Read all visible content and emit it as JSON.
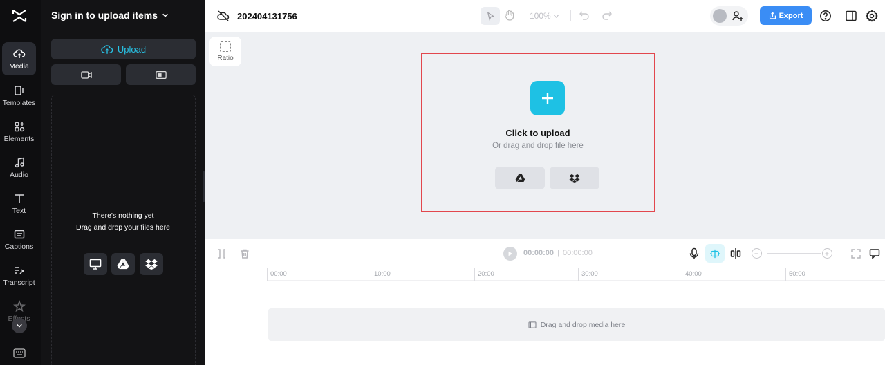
{
  "rail": {
    "items": [
      {
        "label": "Media"
      },
      {
        "label": "Templates"
      },
      {
        "label": "Elements"
      },
      {
        "label": "Audio"
      },
      {
        "label": "Text"
      },
      {
        "label": "Captions"
      },
      {
        "label": "Transcript"
      },
      {
        "label": "Effects"
      }
    ]
  },
  "panel": {
    "title": "Sign in to upload items",
    "upload_label": "Upload",
    "empty_title": "There's nothing yet",
    "empty_subtitle": "Drag and drop your files here"
  },
  "header": {
    "project_name": "202404131756",
    "zoom": "100%",
    "export_label": "Export"
  },
  "canvas": {
    "ratio_label": "Ratio",
    "upload_title": "Click to upload",
    "upload_subtitle": "Or drag and drop file here"
  },
  "timeline": {
    "current_time": "00:00:00",
    "separator": "|",
    "total_time": "00:00:00",
    "ticks": [
      "00:00",
      "10:00",
      "20:00",
      "30:00",
      "40:00",
      "50:00"
    ],
    "track_hint": "Drag and drop media here"
  },
  "colors": {
    "accent": "#1ec1e4",
    "export": "#3a8df5",
    "selection_border": "#e2474d"
  }
}
